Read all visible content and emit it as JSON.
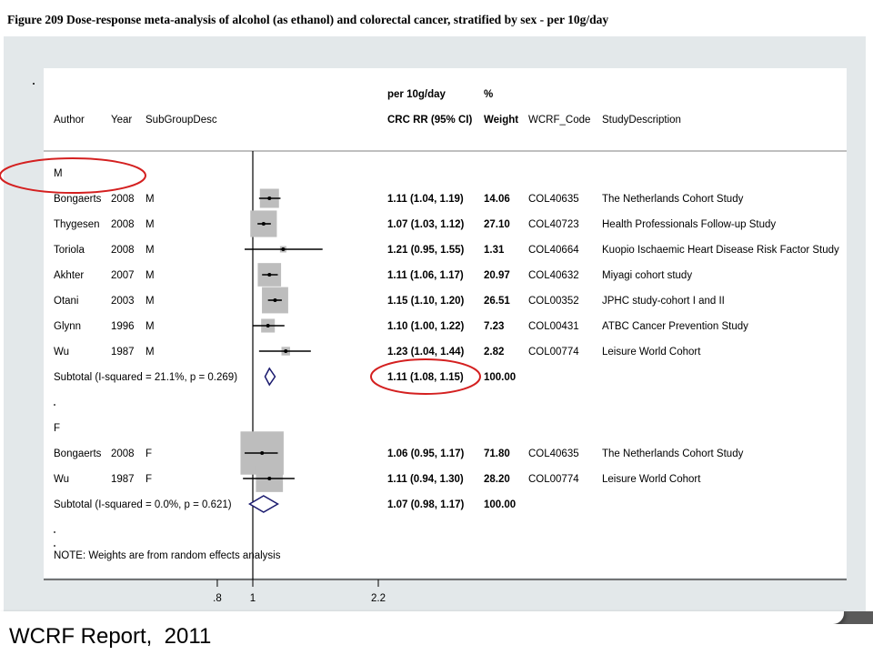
{
  "slide_title": "Figure 209 Dose-response meta-analysis of alcohol (as ethanol) and colorectal cancer, stratified by sex - per 10g/day",
  "footer": "WCRF Report,  2011",
  "chart_data": {
    "type": "forest",
    "headers": {
      "author": "Author",
      "year": "Year",
      "subgroup": "SubGroupDesc",
      "est_top": "per 10g/day",
      "est": "CRC RR (95% CI)",
      "weight_top": "%",
      "weight": "Weight",
      "code": "WCRF_Code",
      "desc": "StudyDescription"
    },
    "x_ticks": [
      {
        "value": 0.8,
        "label": ".8"
      },
      {
        "value": 1,
        "label": "1"
      },
      {
        "value": 2.2,
        "label": "2.2"
      }
    ],
    "x_range": [
      0.7,
      2.4
    ],
    "x_scale": "log",
    "groups": [
      {
        "label": "M",
        "studies": [
          {
            "author": "Bongaerts",
            "year": "2008",
            "sub": "M",
            "rr": 1.11,
            "lo": 1.04,
            "hi": 1.19,
            "est": "1.11 (1.04, 1.19)",
            "weight": "14.06",
            "code": "COL40635",
            "desc": "The Netherlands Cohort Study"
          },
          {
            "author": "Thygesen",
            "year": "2008",
            "sub": "M",
            "rr": 1.07,
            "lo": 1.03,
            "hi": 1.12,
            "est": "1.07 (1.03, 1.12)",
            "weight": "27.10",
            "code": "COL40723",
            "desc": "Health Professionals Follow-up Study"
          },
          {
            "author": "Toriola",
            "year": "2008",
            "sub": "M",
            "rr": 1.21,
            "lo": 0.95,
            "hi": 1.55,
            "est": "1.21 (0.95, 1.55)",
            "weight": "1.31",
            "code": "COL40664",
            "desc": "Kuopio Ischaemic Heart Disease Risk Factor Study"
          },
          {
            "author": "Akhter",
            "year": "2007",
            "sub": "M",
            "rr": 1.11,
            "lo": 1.06,
            "hi": 1.17,
            "est": "1.11 (1.06, 1.17)",
            "weight": "20.97",
            "code": "COL40632",
            "desc": "Miyagi cohort study"
          },
          {
            "author": "Otani",
            "year": "2003",
            "sub": "M",
            "rr": 1.15,
            "lo": 1.1,
            "hi": 1.2,
            "est": "1.15 (1.10, 1.20)",
            "weight": "26.51",
            "code": "COL00352",
            "desc": "JPHC study-cohort I and II"
          },
          {
            "author": "Glynn",
            "year": "1996",
            "sub": "M",
            "rr": 1.1,
            "lo": 1.0,
            "hi": 1.22,
            "est": "1.10 (1.00, 1.22)",
            "weight": "7.23",
            "code": "COL00431",
            "desc": "ATBC Cancer Prevention Study"
          },
          {
            "author": "Wu",
            "year": "1987",
            "sub": "M",
            "rr": 1.23,
            "lo": 1.04,
            "hi": 1.44,
            "est": "1.23 (1.04, 1.44)",
            "weight": "2.82",
            "code": "COL00774",
            "desc": "Leisure World Cohort"
          }
        ],
        "subtotal": {
          "label": "Subtotal  (I-squared = 21.1%, p = 0.269)",
          "rr": 1.11,
          "lo": 1.08,
          "hi": 1.15,
          "est": "1.11 (1.08, 1.15)",
          "weight": "100.00"
        }
      },
      {
        "label": "F",
        "studies": [
          {
            "author": "Bongaerts",
            "year": "2008",
            "sub": "F",
            "rr": 1.06,
            "lo": 0.95,
            "hi": 1.17,
            "est": "1.06 (0.95, 1.17)",
            "weight": "71.80",
            "code": "COL40635",
            "desc": "The Netherlands Cohort Study"
          },
          {
            "author": "Wu",
            "year": "1987",
            "sub": "F",
            "rr": 1.11,
            "lo": 0.94,
            "hi": 1.3,
            "est": "1.11 (0.94, 1.30)",
            "weight": "28.20",
            "code": "COL00774",
            "desc": "Leisure World Cohort"
          }
        ],
        "subtotal": {
          "label": "Subtotal  (I-squared = 0.0%, p = 0.621)",
          "rr": 1.07,
          "lo": 0.98,
          "hi": 1.17,
          "est": "1.07 (0.98, 1.17)",
          "weight": "100.00"
        }
      }
    ],
    "note": "NOTE: Weights are from random effects analysis",
    "annotations": [
      "red ellipse around M group label",
      "red ellipse around M subtotal estimate"
    ],
    "colors": {
      "box": "#bdbdbd",
      "line": "#000000",
      "diamond": "#1a1a6e",
      "highlight": "#d42020"
    }
  }
}
